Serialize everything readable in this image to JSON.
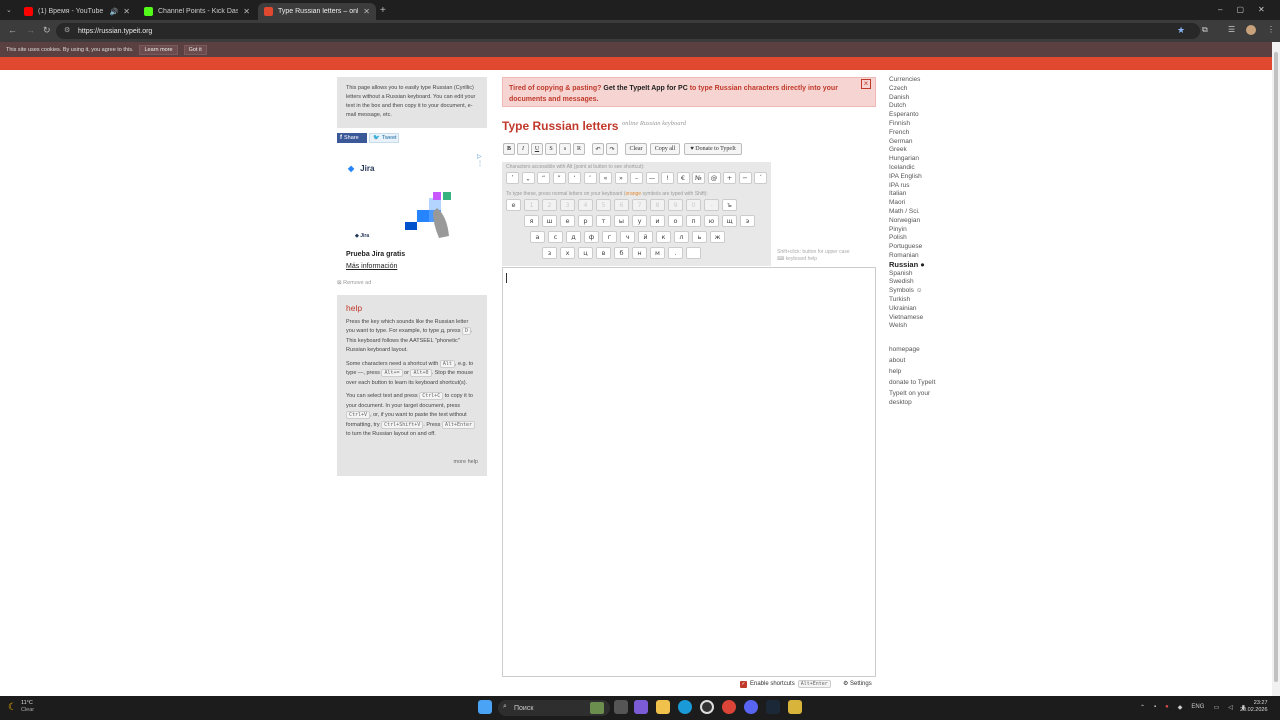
{
  "browser": {
    "tabs": [
      {
        "title": "(1) Время - YouTube",
        "icon_color": "#ff0000"
      },
      {
        "title": "Channel Points - Kick Dashboard",
        "icon_color": "#53fc18"
      },
      {
        "title": "Type Russian letters – online R...",
        "icon_color": "#e0492f"
      }
    ],
    "url": "https://russian.typeit.org"
  },
  "cookie": {
    "text": "This site uses cookies. By using it, you agree to this.",
    "learn": "Learn more",
    "ok": "Got it"
  },
  "left": {
    "intro": "This page allows you to easily type Russian (Cyrillic) letters without a Russian keyboard. You can edit your text in the box and then copy it to your document, e-mail message, etc.",
    "share": "Share",
    "tweet": "Tweet",
    "ad": {
      "brand": "Jira",
      "logo": "Jira",
      "headline": "Prueba Jira gratis",
      "link": "Más información"
    },
    "remove_ad": "Remove ad",
    "help": {
      "title": "help",
      "p1a": "Press the key which sounds like the Russian letter you want to type. For example, to type д, press ",
      "p1k": "D",
      "p1b": ". This keyboard follows the AATSEEL \"phonetic\" Russian keyboard layout.",
      "p2a": "Some characters need a shortcut with ",
      "p2k1": "Alt",
      "p2b": ", e.g. to type —, press ",
      "p2k2": "Alt+=",
      "p2c": " or ",
      "p2k3": "Alt+0",
      "p2d": ". Stop the mouse over each button to learn its keyboard shortcut(s).",
      "p3a": "You can select text and press ",
      "p3k1": "Ctrl+C",
      "p3b": " to copy it to your document. In your target document, press ",
      "p3k2": "Ctrl+V",
      "p3c": ", or, if you want to paste the text without formatting, try ",
      "p3k3": "Ctrl+Shift+V",
      "p3d": ". Press ",
      "p3k4": "Alt+Enter",
      "p3e": " to turn the Russian layout on and off.",
      "more": "more help"
    }
  },
  "center": {
    "banner": {
      "a": "Tired of copying & pasting? ",
      "b": "Get the TypeIt App for PC",
      "c": " to type Russian characters directly into your documents and messages.",
      "close": "×"
    },
    "title": "Type Russian letters",
    "subtitle": "online Russian keyboard",
    "toolbar": {
      "bold": "B",
      "italic": "I",
      "underline": "U",
      "sup": "S",
      "sub": "s",
      "rtl": "R",
      "undo": "↶",
      "redo": "↷",
      "clear": "Clear",
      "copy": "Copy all",
      "donate": "♥ Donate to TypeIt"
    },
    "hint1": "Characters accessible with Alt (point at button to see shortcut):",
    "hint2a": "To type these, press normal letters on your keyboard (",
    "hint2b": "orange",
    "hint2c": " symbols are typed with Shift):",
    "alt_keys": [
      "ʹ",
      "„",
      "“",
      "”",
      "‘",
      "’",
      "«",
      "»",
      "–",
      "—",
      "!",
      "€",
      "№",
      "@",
      "+",
      "−",
      "´"
    ],
    "row1": [
      "е",
      "1",
      "2",
      "3",
      "4",
      "5",
      "6",
      "7",
      "8",
      "9",
      "0",
      "-",
      "ъ"
    ],
    "row2": [
      "я",
      "ш",
      "е",
      "р",
      "т",
      "ы",
      "у",
      "и",
      "о",
      "п",
      "ю",
      "щ",
      "э"
    ],
    "row3": [
      "а",
      "с",
      "д",
      "ф",
      "г",
      "ч",
      "й",
      "к",
      "л",
      "ь",
      "ж"
    ],
    "row4": [
      "з",
      "х",
      "ц",
      "в",
      "б",
      "н",
      "м",
      ".",
      ""
    ],
    "side_hint1": "Shift+click: button for upper case",
    "side_hint2": "keyboard help",
    "shortcuts_label": "Enable shortcuts",
    "shortcuts_key": "Alt+Enter",
    "settings": "Settings"
  },
  "right": {
    "languages": [
      "Currencies",
      "Czech",
      "Danish",
      "Dutch",
      "Esperanto",
      "Finnish",
      "French",
      "German",
      "Greek",
      "Hungarian",
      "Icelandic",
      "IPA English",
      "IPA rus",
      "Italian",
      "Maori",
      "Math / Sci.",
      "Norwegian",
      "Pinyin",
      "Polish",
      "Portuguese",
      "Romanian",
      "Russian ●",
      "Spanish",
      "Swedish",
      "Symbols ☺",
      "Turkish",
      "Ukrainian",
      "Vietnamese",
      "Welsh"
    ],
    "current": "Russian ●",
    "links": [
      "homepage",
      "about",
      "help",
      "donate to TypeIt",
      "TypeIt on your desktop"
    ]
  },
  "taskbar": {
    "weather_temp": "11°C",
    "weather_desc": "Clear",
    "search": "Поиск",
    "lang": "ENG",
    "time": "23:27",
    "date": "20.02.2026"
  }
}
